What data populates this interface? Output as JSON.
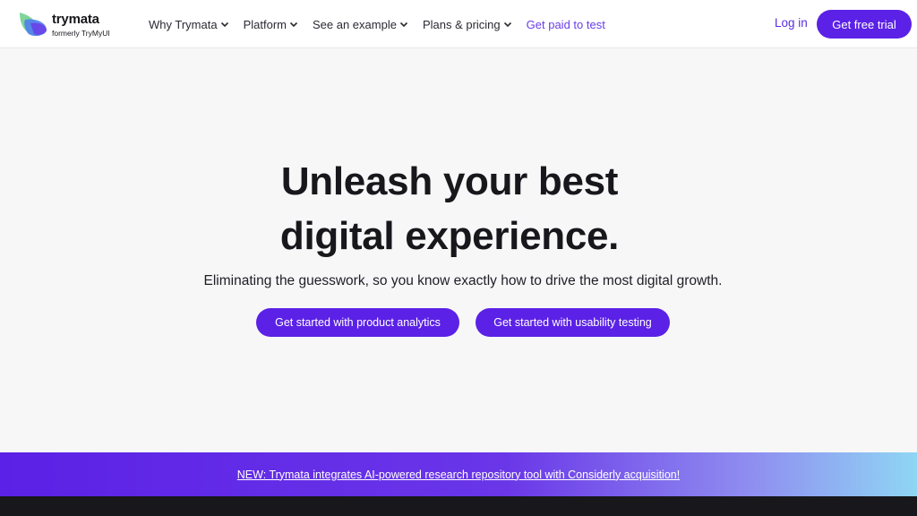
{
  "brand": {
    "name": "trymata",
    "tagline": "formerly TryMyUI",
    "logo_colors": {
      "green": "#7fd49a",
      "blue": "#3b7cf0",
      "purple": "#6a3ee8"
    }
  },
  "nav": {
    "items": [
      {
        "label": "Why Trymata",
        "has_dropdown": true
      },
      {
        "label": "Platform",
        "has_dropdown": true
      },
      {
        "label": "See an example",
        "has_dropdown": true
      },
      {
        "label": "Plans & pricing",
        "has_dropdown": true
      },
      {
        "label": "Get paid to test",
        "has_dropdown": false
      }
    ],
    "login": "Log in",
    "trial": "Get free trial"
  },
  "hero": {
    "title_line1": "Unleash your best",
    "title_line2": "digital experience.",
    "subtitle": "Eliminating the guesswork, so you know exactly how to drive the most digital growth.",
    "cta_primary": "Get started with product analytics",
    "cta_secondary": "Get started with usability testing"
  },
  "banner": {
    "text": "NEW: Trymata integrates AI-powered research repository tool with Considerly acquisition!"
  },
  "colors": {
    "accent": "#5b21e6",
    "accent_text": "#6a3ee8",
    "background": "#f7f7f8",
    "dark": "#17171c"
  }
}
